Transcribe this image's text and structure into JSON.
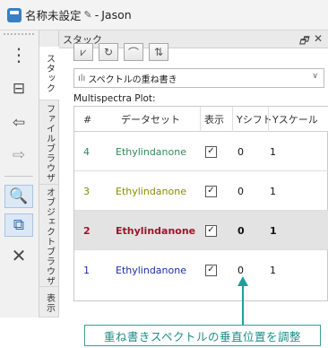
{
  "window": {
    "title": "名称未設定",
    "separator": "-",
    "user": "Jason"
  },
  "toolstrip": {
    "tools": [
      "menu-dots-icon",
      "window-icon",
      "undo-icon",
      "redo-icon",
      "zoom-icon",
      "zoom-region-icon",
      "crosshair-icon"
    ]
  },
  "side_tabs": {
    "items": [
      {
        "label": "スタック"
      },
      {
        "label": "ファイルブラウザ"
      },
      {
        "label": "オブジェクトブラウザ"
      },
      {
        "label": "表示"
      }
    ]
  },
  "panel": {
    "title": "スタック",
    "float_icon": "🗗",
    "close_icon": "✕"
  },
  "toolbar": {
    "buttons": [
      "stack-overlay-icon",
      "refresh-icon",
      "peaks-icon",
      "sort-icon"
    ],
    "glyphs": [
      "⩗",
      "↻",
      "⌒",
      "⇅"
    ]
  },
  "mode_select": {
    "value": "スペクトルの重ね書き",
    "arrow": "∨",
    "icon_glyph": "ılı"
  },
  "multispectra": {
    "label": "Multispectra Plot:"
  },
  "table": {
    "headers": [
      "#",
      "データセット",
      "表示",
      "Yシフト",
      "Yスケール"
    ],
    "rows": [
      {
        "index": "4",
        "dataset": "Ethylindanone",
        "shown": "☑",
        "yshift": "0",
        "yscale": "1",
        "color": "#2e8b57"
      },
      {
        "index": "3",
        "dataset": "Ethylindanone",
        "shown": "☑",
        "yshift": "0",
        "yscale": "1",
        "color": "#8a8a00"
      },
      {
        "index": "2",
        "dataset": "Ethylindanone",
        "shown": "☑",
        "yshift": "0",
        "yscale": "1",
        "color": "#a0142a"
      },
      {
        "index": "1",
        "dataset": "Ethylindanone",
        "shown": "☑",
        "yshift": "0",
        "yscale": "1",
        "color": "#1a2fa0"
      }
    ]
  },
  "annotation": {
    "text": "重ね書きスペクトルの垂直位置を調整",
    "color": "#1f9e9a"
  }
}
